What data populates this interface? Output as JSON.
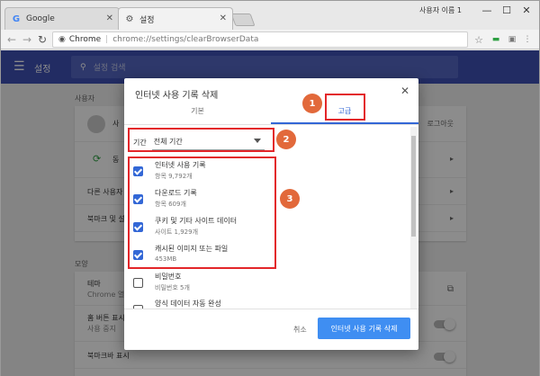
{
  "browser": {
    "tabs": [
      {
        "title": "Google",
        "icon": "google-icon"
      },
      {
        "title": "설정",
        "icon": "gear-icon"
      }
    ],
    "profile_name": "사용자 이름 1",
    "window_controls": {
      "minimize": "—",
      "maximize": "☐",
      "close": "✕"
    },
    "url_scheme_label": "Chrome",
    "url_path": "chrome://settings/clearBrowserData"
  },
  "settings_page": {
    "title": "설정",
    "search_placeholder": "설정 검색",
    "people_section": "사용자",
    "people_rows": [
      {
        "label": "사",
        "action": "로그아웃"
      },
      {
        "label": "동"
      },
      {
        "label": "다른 사용자"
      },
      {
        "label": "북마크 및 설"
      }
    ],
    "appearance_section": "모양",
    "appearance_rows": [
      {
        "label": "테마",
        "sub": "Chrome 열"
      },
      {
        "label": "홈 버튼 표시",
        "sub": "사용 중지"
      },
      {
        "label": "북마크바 표시"
      }
    ]
  },
  "dialog": {
    "title": "인터넷 사용 기록 삭제",
    "tabs": {
      "basic": "기본",
      "advanced": "고급"
    },
    "period_label": "기간",
    "period_value": "전체 기간",
    "items": [
      {
        "label": "인터넷 사용 기록",
        "sub": "항목 9,792개",
        "checked": true
      },
      {
        "label": "다운로드 기록",
        "sub": "항목 609개",
        "checked": true
      },
      {
        "label": "쿠키 및 기타 사이트 데이터",
        "sub": "사이트 1,929개",
        "checked": true
      },
      {
        "label": "캐시된 이미지 또는 파일",
        "sub": "453MB",
        "checked": true
      },
      {
        "label": "비밀번호",
        "sub": "비밀번호 5개",
        "checked": false
      },
      {
        "label": "양식 데이터 자동 완성",
        "sub": "",
        "checked": false
      }
    ],
    "cancel_label": "취소",
    "confirm_label": "인터넷 사용 기록 삭제"
  },
  "annotations": {
    "badges": [
      "1",
      "2",
      "3"
    ],
    "highlight_color": "#e3262a",
    "badge_color": "#e2693b"
  },
  "colors": {
    "header": "#3f51b5",
    "accent": "#3367d6",
    "primary_button": "#3f8ef2"
  }
}
